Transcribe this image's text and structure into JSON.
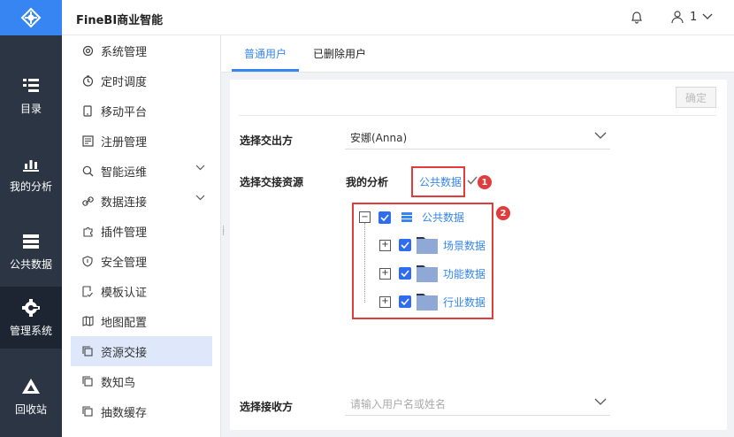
{
  "app": {
    "title": "FineBI商业智能"
  },
  "user": {
    "name": "1"
  },
  "leftnav": {
    "items": [
      {
        "label": "目录",
        "icon": "catalog-icon"
      },
      {
        "label": "我的分析",
        "icon": "chart-icon"
      },
      {
        "label": "公共数据",
        "icon": "database-icon"
      },
      {
        "label": "管理系统",
        "icon": "gear-icon"
      },
      {
        "label": "回收站",
        "icon": "recycle-icon"
      }
    ]
  },
  "sidebar": {
    "items": [
      {
        "label": "系统管理",
        "icon": "settings-icon"
      },
      {
        "label": "定时调度",
        "icon": "timer-icon"
      },
      {
        "label": "移动平台",
        "icon": "mobile-icon"
      },
      {
        "label": "注册管理",
        "icon": "register-icon"
      },
      {
        "label": "智能运维",
        "icon": "ops-icon"
      },
      {
        "label": "数据连接",
        "icon": "link-icon"
      },
      {
        "label": "插件管理",
        "icon": "plugin-icon"
      },
      {
        "label": "安全管理",
        "icon": "shield-icon"
      },
      {
        "label": "模板认证",
        "icon": "template-icon"
      },
      {
        "label": "地图配置",
        "icon": "map-icon"
      },
      {
        "label": "资源交接",
        "icon": "copy-icon"
      },
      {
        "label": "数知鸟",
        "icon": "copy-icon"
      },
      {
        "label": "抽数缓存",
        "icon": "copy-icon"
      }
    ]
  },
  "tabs": {
    "normal_users": "普通用户",
    "deleted_users": "已删除用户"
  },
  "form": {
    "confirm": "确定",
    "from_label": "选择交出方",
    "from_value": "安娜(Anna)",
    "resource_label": "选择交接资源",
    "sub_tabs": {
      "my_analysis": "我的分析",
      "public_data": "公共数据"
    },
    "receiver_label": "选择接收方",
    "receiver_placeholder": "请输入用户名或姓名"
  },
  "annotations": {
    "badge1": "1",
    "badge2": "2"
  },
  "tree": {
    "root": "公共数据",
    "children": [
      "场景数据",
      "功能数据",
      "行业数据"
    ]
  },
  "colors": {
    "accent": "#3685f2",
    "nav_bg": "#2b3543",
    "annotation_red": "#e23b3b"
  }
}
